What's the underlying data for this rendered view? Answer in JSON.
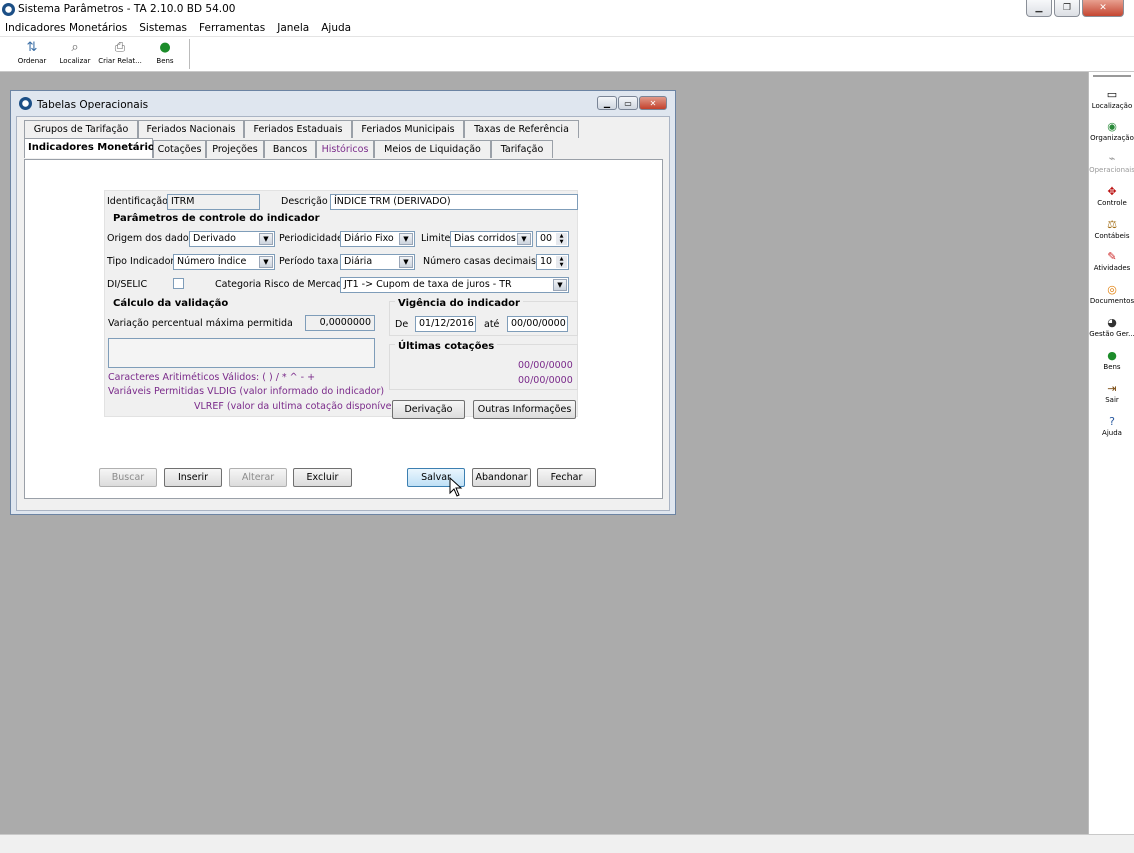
{
  "window": {
    "title": "Sistema Parâmetros -  TA 2.10.0 BD 54.00"
  },
  "menu": [
    "Indicadores Monetários",
    "Sistemas",
    "Ferramentas",
    "Janela",
    "Ajuda"
  ],
  "toolbar": [
    {
      "label": "Ordenar",
      "icon": "sort-icon"
    },
    {
      "label": "Localizar",
      "icon": "find-icon"
    },
    {
      "label": "Criar Relat...",
      "icon": "print-icon"
    },
    {
      "label": "Bens",
      "icon": "money-bag-icon"
    }
  ],
  "right_panel": [
    {
      "label": "Localização",
      "icon": "location-icon"
    },
    {
      "label": "Organização",
      "icon": "organization-icon"
    },
    {
      "label": "Operacionais",
      "icon": "operational-icon",
      "disabled": true
    },
    {
      "label": "Controle",
      "icon": "control-icon"
    },
    {
      "label": "Contábeis",
      "icon": "balance-icon"
    },
    {
      "label": "Atividades",
      "icon": "activities-icon"
    },
    {
      "label": "Documentos",
      "icon": "documents-icon"
    },
    {
      "label": "Gestão Ger...",
      "icon": "management-icon"
    },
    {
      "label": "Bens",
      "icon": "money-bag-icon"
    },
    {
      "label": "Sair",
      "icon": "exit-icon"
    },
    {
      "label": "Ajuda",
      "icon": "help-icon"
    }
  ],
  "child": {
    "title": "Tabelas Operacionais",
    "tabs_row1": [
      "Grupos de Tarifação",
      "Feriados Nacionais",
      "Feriados Estaduais",
      "Feriados Municipais",
      "Taxas de Referência"
    ],
    "tabs_row2": [
      "Indicadores Monetários",
      "Cotações",
      "Projeções",
      "Bancos",
      "Históricos",
      "Meios de Liquidação",
      "Tarifação"
    ],
    "form": {
      "identificacao_label": "Identificação",
      "identificacao": "ITRM",
      "descricao_label": "Descrição",
      "descricao": "ÍNDICE TRM (DERIVADO)",
      "params_title": "Parâmetros de controle do indicador",
      "origem_label": "Origem dos dados",
      "origem": "Derivado",
      "periodicidade_label": "Periodicidade",
      "periodicidade": "Diário Fixo",
      "limite_label": "Limite",
      "limite": "Dias corridos",
      "limite_num": "00",
      "tipo_label": "Tipo Indicador",
      "tipo": "Número Índice",
      "periodo_label": "Período taxa",
      "periodo": "Diária",
      "casas_label": "Número casas decimais",
      "casas": "10",
      "diselic_label": "DI/SELIC",
      "categoria_label": "Categoria Risco de Mercado",
      "categoria": "JT1 -> Cupom de taxa de juros - TR",
      "calc_title": "Cálculo da validação",
      "variacao_label": "Variação percentual máxima permitida",
      "variacao": "0,0000000",
      "caracteres": "Caracteres Aritiméticos Válidos:   ( ) / * ^ - +",
      "variaveis": "Variáveis Permitidas VLDIG  (valor informado do indicador)",
      "vlref": "VLREF (valor da ultima cotação disponível)",
      "vigencia_title": "Vigência do indicador",
      "de_label": "De",
      "de": "01/12/2016",
      "ate_label": "até",
      "ate": "00/00/0000",
      "ultimas_title": "Últimas cotações",
      "ultimas": [
        "00/00/0000",
        "00/00/0000"
      ],
      "derivacao_btn": "Derivação",
      "outras_btn": "Outras Informações"
    },
    "buttons": {
      "buscar": "Buscar",
      "inserir": "Inserir",
      "alterar": "Alterar",
      "excluir": "Excluir",
      "salvar": "Salvar",
      "abandonar": "Abandonar",
      "fechar": "Fechar"
    }
  }
}
